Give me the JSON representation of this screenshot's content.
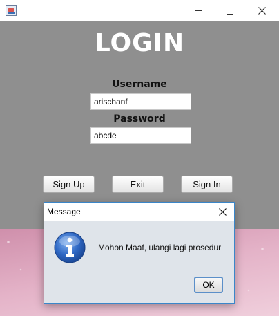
{
  "window": {
    "title": "",
    "heading": "LOGIN",
    "username_label": "Username",
    "username_value": "arischanf",
    "password_label": "Password",
    "password_value": "abcde",
    "buttons": {
      "signup": "Sign Up",
      "exit": "Exit",
      "signin": "Sign In"
    },
    "panel_color": "#8f8f8f"
  },
  "dialog": {
    "title": "Message",
    "icon": "info-icon",
    "message": "Mohon Maaf, ulangi lagi prosedur",
    "ok_label": "OK"
  },
  "icons": {
    "app": "java-app-icon",
    "minimize": "minimize-icon",
    "maximize": "maximize-icon",
    "close": "close-icon"
  }
}
